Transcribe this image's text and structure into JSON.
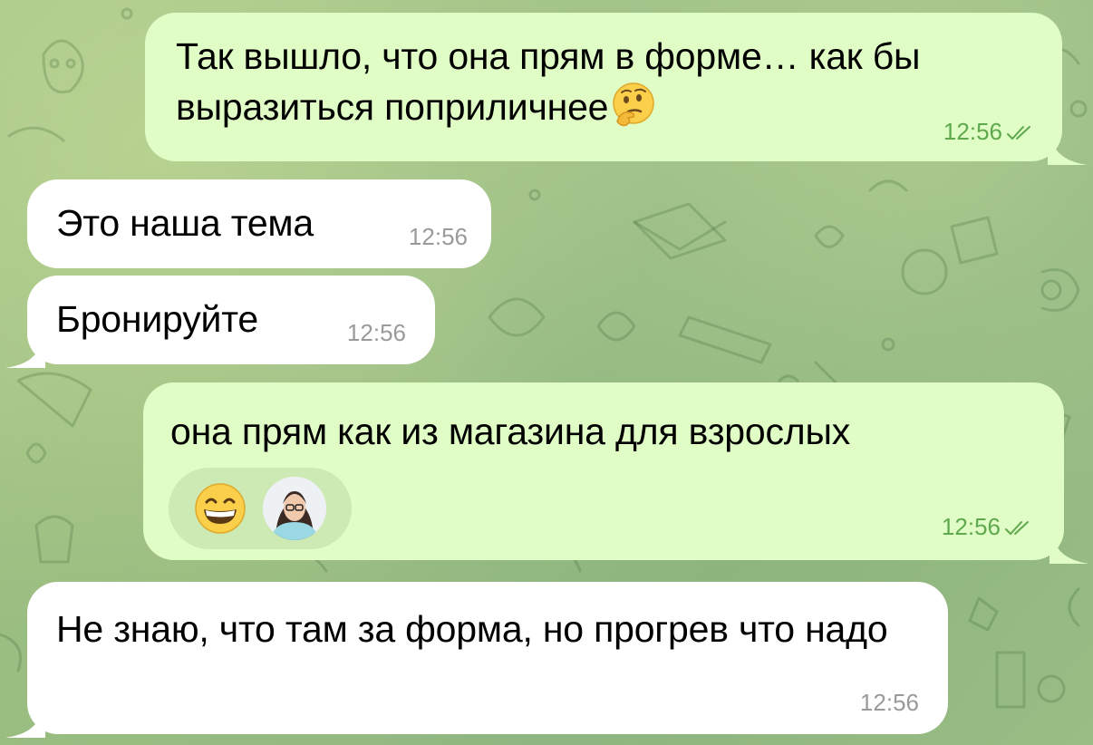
{
  "messages": [
    {
      "direction": "outgoing",
      "text": "Так вышло, что она прям в форме… как бы выразиться поприличнее",
      "time": "12:56",
      "read": true,
      "emoji": "thinking-face"
    },
    {
      "direction": "incoming",
      "text": "Это наша тема",
      "time": "12:56"
    },
    {
      "direction": "incoming",
      "text": "Бронируйте",
      "time": "12:56"
    },
    {
      "direction": "outgoing",
      "text": "она прям как из магазина для взрослых",
      "time": "12:56",
      "read": true,
      "reaction": {
        "emoji": "grinning-face",
        "reactor": "user-avatar"
      }
    },
    {
      "direction": "incoming",
      "text": "Не знаю, что там за форма, но прогрев что надо",
      "time": "12:56"
    }
  ],
  "colors": {
    "outgoing_bubble": "#e1fdc6",
    "incoming_bubble": "#ffffff",
    "outgoing_meta": "#5ea94e",
    "incoming_meta": "#9a9a9a",
    "reaction_pill": "#cdeab4"
  }
}
